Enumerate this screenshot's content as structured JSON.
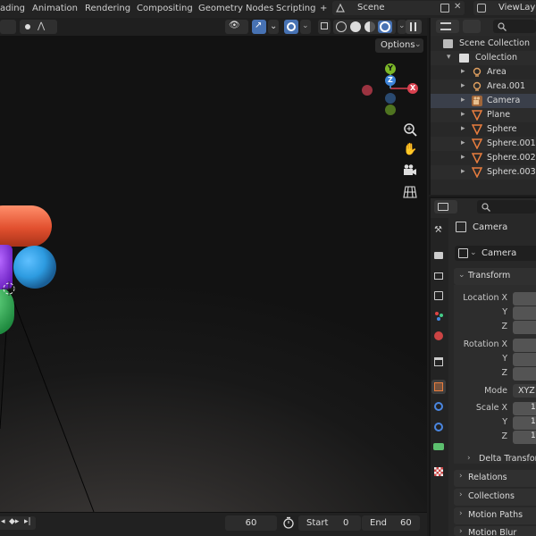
{
  "topbar": {
    "menus": [
      "ading",
      "Animation",
      "Rendering",
      "Compositing",
      "Geometry Nodes",
      "Scripting"
    ],
    "add_tab": "+",
    "scene_name": "Scene",
    "view_layer": "ViewLaye"
  },
  "viewport": {
    "options_label": "Options",
    "axes": {
      "x": "X",
      "y": "Y",
      "z": "Z"
    }
  },
  "timeline": {
    "current_frame": "60",
    "start_label": "Start",
    "start_value": "0",
    "end_label": "End",
    "end_value": "60"
  },
  "outliner": {
    "root": "Scene Collection",
    "collection": "Collection",
    "items": [
      {
        "name": "Area",
        "icon": "light-icon"
      },
      {
        "name": "Area.001",
        "icon": "light-icon"
      },
      {
        "name": "Camera",
        "icon": "camera-icon"
      },
      {
        "name": "Plane",
        "icon": "mesh-icon"
      },
      {
        "name": "Sphere",
        "icon": "mesh-icon"
      },
      {
        "name": "Sphere.001",
        "icon": "mesh-icon"
      },
      {
        "name": "Sphere.002",
        "icon": "mesh-icon"
      },
      {
        "name": "Sphere.003",
        "icon": "mesh-icon"
      }
    ]
  },
  "properties": {
    "object_name": "Camera",
    "object_field": "Camera",
    "transform": {
      "title": "Transform",
      "location": [
        "Location X",
        "Y",
        "Z"
      ],
      "rotation": [
        "Rotation X",
        "Y",
        "Z"
      ],
      "mode_label": "Mode",
      "mode_value": "XYZ",
      "scale": [
        "Scale X",
        "Y",
        "Z"
      ],
      "scale_values": [
        "1",
        "1",
        "1"
      ],
      "delta": "Delta Transform"
    },
    "panels": [
      "Relations",
      "Collections",
      "Motion Paths",
      "Motion Blur"
    ]
  },
  "colors": {
    "accent": "#4772b3",
    "mesh_orange": "#e87d3e",
    "light_orange": "#e0a060",
    "axis_x": "#d9414f",
    "axis_y": "#7bb728",
    "axis_z": "#3d84d9"
  }
}
